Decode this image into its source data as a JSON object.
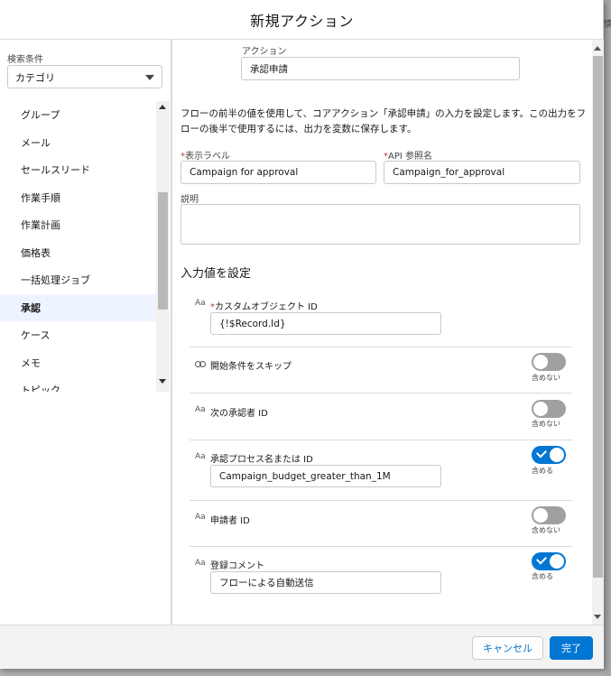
{
  "header": {
    "title": "新規アクション"
  },
  "left": {
    "search_label": "検索条件",
    "category_value": "カテゴリ",
    "items": [
      "グループ",
      "メール",
      "セールスリード",
      "作業手順",
      "作業計画",
      "価格表",
      "一括処理ジョブ",
      "承認",
      "ケース",
      "メモ",
      "トピック"
    ]
  },
  "form": {
    "action_label": "アクション",
    "action_value": "承認申請",
    "description_text": "フローの前半の値を使用して、コアアクション「承認申請」の入力を設定します。この出力をフローの後半で使用するには、出力を変数に保存します。",
    "display_label_label": "表示ラベル",
    "display_label_value": "Campaign for approval",
    "api_name_label": "API 参照名",
    "api_name_value": "Campaign_for_approval",
    "description_label": "説明",
    "description_value": "",
    "required_mark": "*"
  },
  "inputs": {
    "section_title": "入力値を設定",
    "type_icon": "Aa",
    "custom_object_label": "カスタムオブジェクト ID",
    "custom_object_value": "{!$Record.Id}",
    "skip_label": "開始条件をスキップ",
    "skip_toggle": "含めない",
    "next_approver_label": "次の承認者 ID",
    "next_approver_toggle": "含めない",
    "process_label": "承認プロセス名または ID",
    "process_toggle": "含める",
    "process_value": "Campaign_budget_greater_than_1M",
    "requester_label": "申請者 ID",
    "requester_toggle": "含めない",
    "comment_label": "登録コメント",
    "comment_toggle": "含める",
    "comment_value": "フローによる自動送信"
  },
  "footer": {
    "cancel_label": "キャンセル",
    "done_label": "完了"
  },
  "colors": {
    "brand": "#0176d3",
    "toggle_off": "#a0a0a0",
    "active_item_bg": "#eef4ff"
  }
}
